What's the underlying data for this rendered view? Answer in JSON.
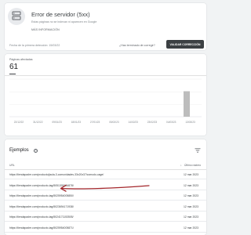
{
  "error_card": {
    "title": "Error de servidor (5xx)",
    "description": "Estas páginas no se indexan ni aparecen en Google",
    "more_info": "MÁS INFORMACIÓN",
    "first_detected": "Fecha de la primera detección: 15/03/22",
    "fixed_question": "¿Has terminado de corregir?",
    "validate_button": "VALIDAR CORRECCIÓN",
    "icon": "server-error-icon"
  },
  "metric": {
    "label": "Páginas afectadas",
    "value": "61"
  },
  "chart_data": {
    "type": "bar",
    "categories": [
      "22/12/22",
      "31/12/22",
      "09/01/23",
      "18/01/23",
      "27/01/23",
      "05/02/23",
      "14/02/23",
      "23/02/23",
      "04/03/23",
      "13/03/23"
    ],
    "series_values": [
      {
        "date": "15/03/23",
        "value": 61
      }
    ],
    "ylim": [
      0,
      90
    ],
    "grid": true,
    "bar_color": "#bdbdbd"
  },
  "examples": {
    "title": "Ejemplos",
    "help_icon": "help-icon",
    "filter_icon": "filter-icon",
    "col_url": "URL",
    "col_last_crawl": "Último rastreo",
    "rows": [
      {
        "url": "https://tiendapadre.com/producto/jaula-3-comunidades-33x20x37/comodo-cage/",
        "date": "12 mar 2023"
      },
      {
        "url": "https://tiendapadre.com/producto-tag/5051305134878/",
        "date": "12 mar 2023"
      },
      {
        "url": "https://tiendapadre.com/producto-tag/5025954005850/",
        "date": "12 mar 2023"
      },
      {
        "url": "https://tiendapadre.com/producto-tag/5023694171938/",
        "date": "12 mar 2023"
      },
      {
        "url": "https://tiendapadre.com/producto-tag/5024171153505/",
        "date": "12 mar 2023"
      },
      {
        "url": "https://tiendapadre.com/producto-tag/5025954005871/",
        "date": "12 mar 2023"
      }
    ]
  }
}
